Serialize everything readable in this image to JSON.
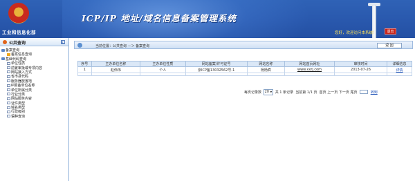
{
  "header": {
    "ministry_name": "工业和信息化部",
    "system_title": "ICP/IP 地址/域名信息备案管理系统",
    "welcome_text": "您好，欢迎访问本系统！",
    "logout_label": "退出"
  },
  "sidebar": {
    "title": "公共查询",
    "tree": [
      {
        "label": "备案查询",
        "level": 0
      },
      {
        "label": "备案信息查询",
        "level": 1
      },
      {
        "label": "基础代码查询",
        "level": 0
      },
      {
        "label": "单位性质",
        "level": 1
      },
      {
        "label": "前置审批或专项内容",
        "level": 1
      },
      {
        "label": "网站接入方式",
        "level": 1
      },
      {
        "label": "省市县代码",
        "level": 1
      },
      {
        "label": "服务器放置地",
        "level": 1
      },
      {
        "label": "IP报备单位名称",
        "level": 1
      },
      {
        "label": "单位所属分类",
        "level": 1
      },
      {
        "label": "行业分类",
        "level": 1
      },
      {
        "label": "网站服务内容",
        "level": 1
      },
      {
        "label": "证件类型",
        "level": 1
      },
      {
        "label": "域名类型",
        "level": 1
      },
      {
        "label": "行政级别",
        "level": 1
      },
      {
        "label": "语种查询",
        "level": 1
      }
    ]
  },
  "breadcrumb": {
    "text": "当前位置：公共查询 －＞ 备案查询",
    "back_label": "返 回"
  },
  "table": {
    "columns": [
      "序号",
      "主办单位名称",
      "主办单位性质",
      "网站备案/许可证号",
      "网站名称",
      "网站首页网址",
      "审核时间",
      "详细信息"
    ],
    "rows": [
      [
        "1",
        "赵伟伟",
        "个人",
        "京ICP备13032562号-1",
        "杨杨疯",
        "www.xxrj.com",
        "2013-07-26",
        "详情"
      ]
    ]
  },
  "pager": {
    "per_page_label": "每页记录数",
    "per_page_value": "20",
    "total_text": "共 1 条记录",
    "page_text": "当前第 1/1 页",
    "first": "首页",
    "prev": "上一页",
    "next": "下一页",
    "last": "尾页",
    "go_label": "转到"
  }
}
